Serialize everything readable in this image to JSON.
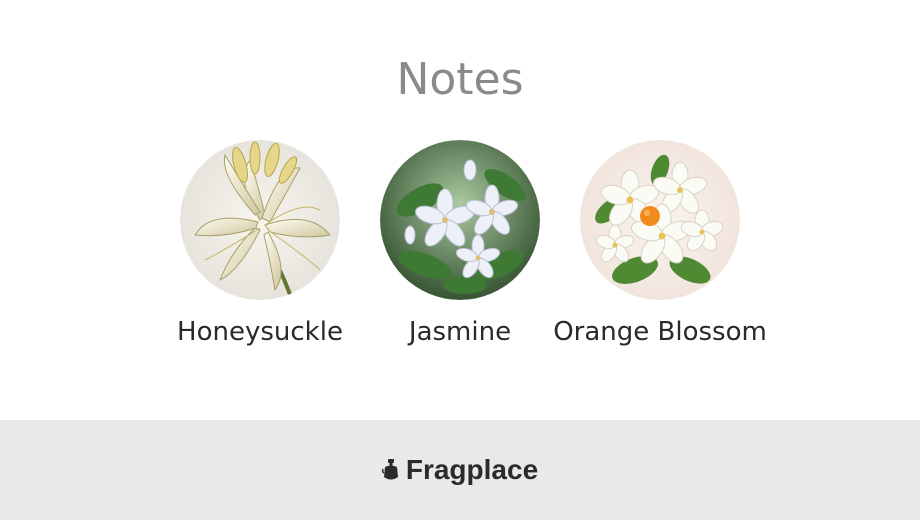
{
  "header": {
    "title": "Notes"
  },
  "notes": [
    {
      "label": "Honeysuckle",
      "image": "honeysuckle-flower-image"
    },
    {
      "label": "Jasmine",
      "image": "jasmine-flower-image"
    },
    {
      "label": "Orange Blossom",
      "image": "orange-blossom-flower-image"
    }
  ],
  "footer": {
    "brand": "Fragplace",
    "icon": "perfume-bottle-icon",
    "background": "#e9e9e9"
  }
}
